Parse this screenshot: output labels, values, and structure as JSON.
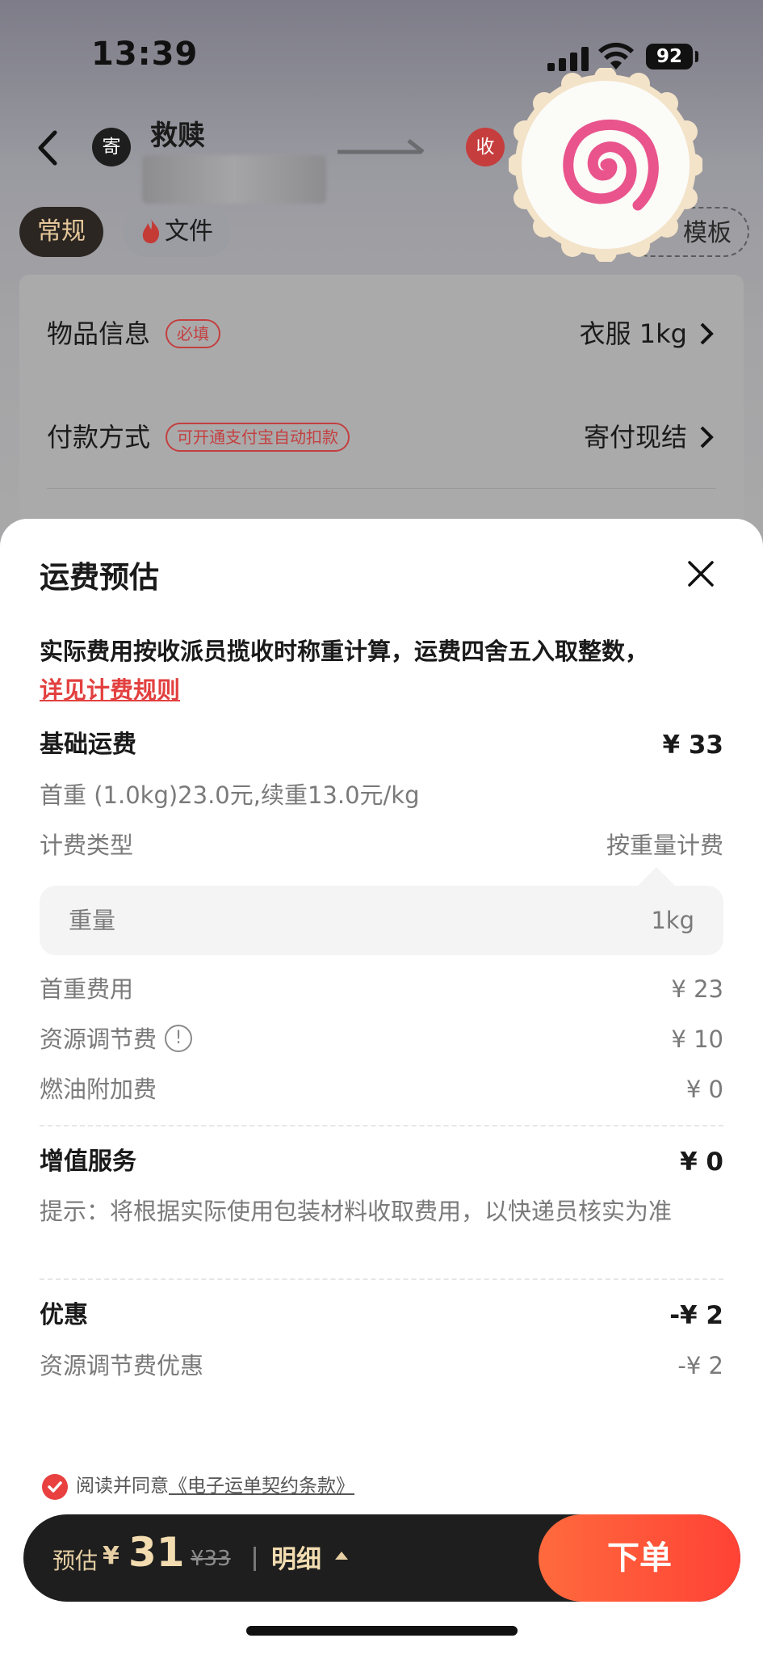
{
  "status_bar": {
    "time": "13:39",
    "battery": "92"
  },
  "header": {
    "send_badge": "寄",
    "sender_name": "救赎",
    "recv_badge": "收"
  },
  "tags": {
    "regular": "常规",
    "file": "文件",
    "template": "模板"
  },
  "background_form": {
    "rows": [
      {
        "label": "物品信息",
        "pill": "必填",
        "value": "衣服 1kg"
      },
      {
        "label": "付款方式",
        "pill": "可开通支付宝自动扣款",
        "value": "寄付现结"
      }
    ]
  },
  "sheet": {
    "title": "运费预估",
    "notice": "实际费用按收派员揽收时称重计算，运费四舍五入取整数，",
    "rule_link": "详见计费规则",
    "base_fee": {
      "label": "基础运费",
      "amount": "¥ 33",
      "formula": "首重 (1.0kg)23.0元,续重13.0元/kg",
      "billing_type_label": "计费类型",
      "billing_type_value": "按重量计费",
      "weight_label": "重量",
      "weight_value": "1kg",
      "items": [
        {
          "label": "首重费用",
          "value": "¥ 23"
        },
        {
          "label": "资源调节费",
          "value": "¥ 10"
        },
        {
          "label": "燃油附加费",
          "value": "¥ 0"
        }
      ]
    },
    "value_added": {
      "label": "增值服务",
      "amount": "¥ 0",
      "tip": "提示：将根据实际使用包装材料收取费用，以快递员核实为准"
    },
    "discount": {
      "label": "优惠",
      "amount": "-¥ 2",
      "item_label": "资源调节费优惠",
      "item_value": "-¥ 2"
    },
    "agreement": {
      "prefix": "阅读并同意",
      "terms": "《电子运单契约条款》"
    }
  },
  "bottom_bar": {
    "estimate_label": "预估",
    "currency": "¥",
    "price": "31",
    "original_price": "¥33",
    "detail_label": "明细",
    "order_label": "下单"
  },
  "colors": {
    "accent": "#ff4a36",
    "link": "#e2403f",
    "gold": "#e6cfa4"
  }
}
